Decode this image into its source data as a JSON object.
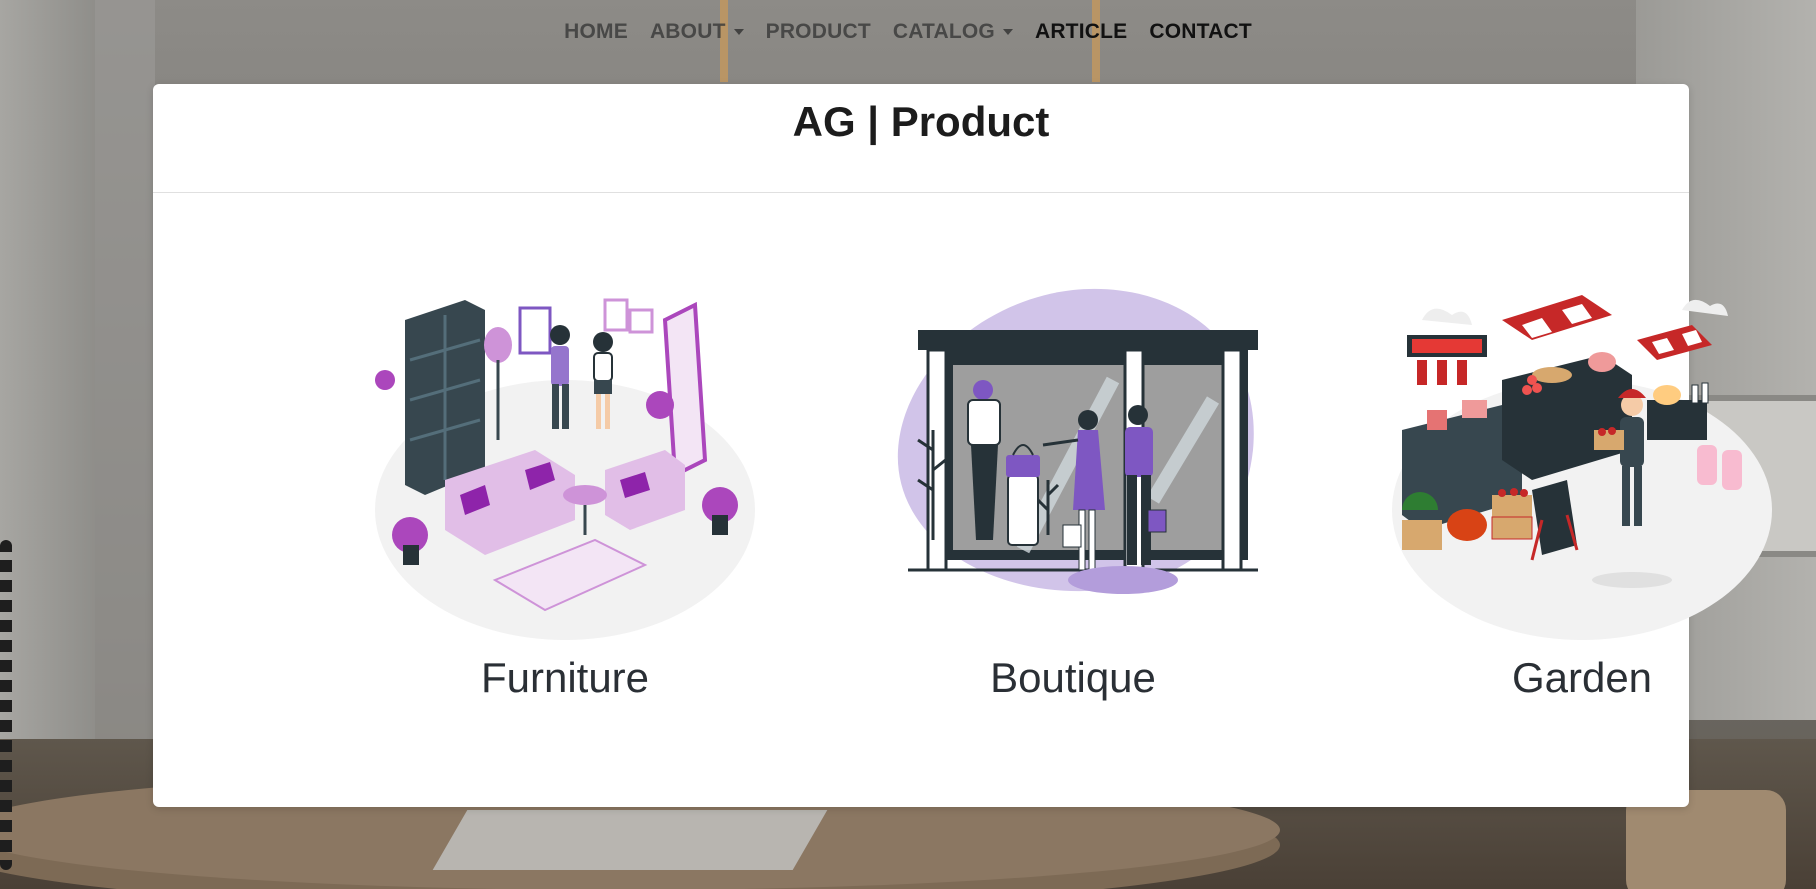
{
  "nav": {
    "items": [
      {
        "label": "HOME",
        "dropdown": false
      },
      {
        "label": "ABOUT",
        "dropdown": true
      },
      {
        "label": "PRODUCT",
        "dropdown": false
      },
      {
        "label": "CATALOG",
        "dropdown": true
      },
      {
        "label": "ARTICLE",
        "dropdown": false
      },
      {
        "label": "CONTACT",
        "dropdown": false
      }
    ]
  },
  "card": {
    "title": "AG | Product"
  },
  "products": [
    {
      "label": "Furniture",
      "illustration": "furniture-room-illustration"
    },
    {
      "label": "Boutique",
      "illustration": "boutique-storefront-illustration"
    },
    {
      "label": "Garden",
      "illustration": "farmers-market-illustration"
    }
  ],
  "colors": {
    "accent": "#7e57c2",
    "accent_light": "#d9c9ec",
    "dark": "#263238",
    "red": "#c62828",
    "card_bg": "#ffffff"
  }
}
